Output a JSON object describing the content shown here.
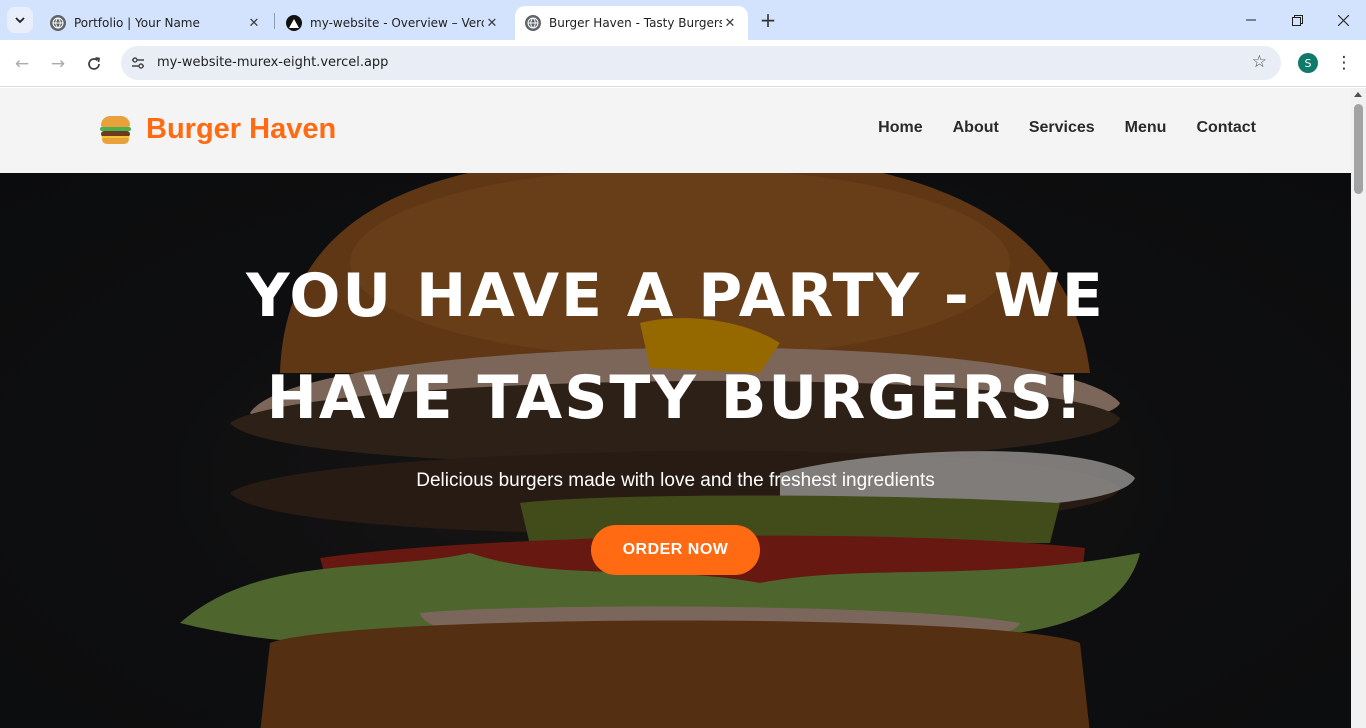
{
  "browser": {
    "tabs": [
      {
        "title": "Portfolio | Your Name",
        "favicon": "globe-icon",
        "active": false
      },
      {
        "title": "my-website - Overview – Vercel",
        "favicon": "vercel-triangle-icon",
        "active": false
      },
      {
        "title": "Burger Haven - Tasty Burgers!",
        "favicon": "globe-icon",
        "active": true
      }
    ],
    "url": "my-website-murex-eight.vercel.app",
    "profile_initial": "S",
    "colors": {
      "tabstrip": "#d3e3fd",
      "omnibox": "#e9eef6",
      "profile": "#0f7a6a"
    }
  },
  "site": {
    "brand": "Burger Haven",
    "brand_icon": "burger-icon",
    "nav": [
      "Home",
      "About",
      "Services",
      "Menu",
      "Contact"
    ],
    "hero": {
      "title": "YOU HAVE A PARTY - WE HAVE TASTY BURGERS!",
      "subtitle": "Delicious burgers made with love and the freshest ingredients",
      "cta": "ORDER NOW"
    },
    "colors": {
      "accent": "#ff6a13",
      "header_bg": "#f4f4f4",
      "nav_text": "#2a2a2a"
    }
  }
}
